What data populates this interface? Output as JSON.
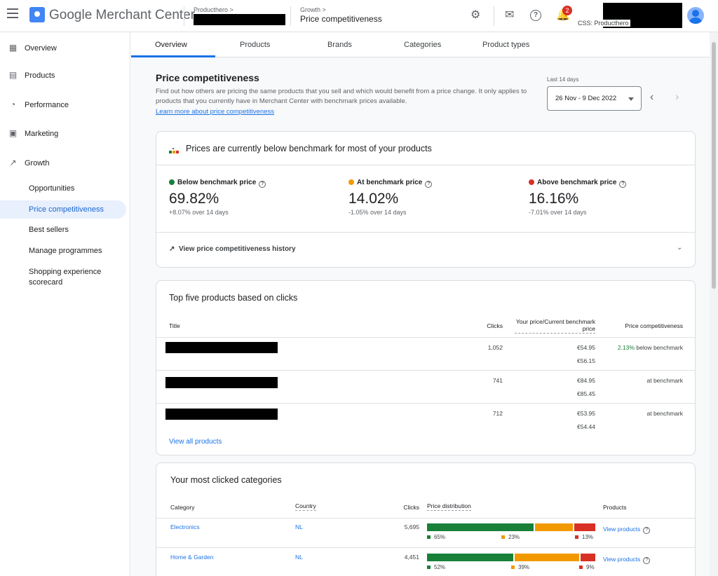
{
  "header": {
    "app_name": "Google Merchant Center",
    "account_breadcrumb": "Producthero",
    "section_breadcrumb": "Growth",
    "page_name": "Price competitiveness",
    "notification_count": "2",
    "css_label": "CSS: Producthero",
    "breadcrumb_chevron": ">"
  },
  "sidebar": {
    "items": [
      {
        "label": "Overview",
        "icon": "dashboard-icon"
      },
      {
        "label": "Products",
        "icon": "list-icon"
      },
      {
        "label": "Performance",
        "icon": "performance-icon"
      },
      {
        "label": "Marketing",
        "icon": "marketing-icon"
      },
      {
        "label": "Growth",
        "icon": "trending-up-icon"
      }
    ],
    "growth_sub": [
      {
        "label": "Opportunities"
      },
      {
        "label": "Price competitiveness"
      },
      {
        "label": "Best sellers"
      },
      {
        "label": "Manage programmes"
      },
      {
        "label": "Shopping experience scorecard"
      }
    ]
  },
  "tabs": [
    "Overview",
    "Products",
    "Brands",
    "Categories",
    "Product types"
  ],
  "page": {
    "title": "Price competitiveness",
    "description": "Find out how others are pricing the same products that you sell and which would benefit from a price change. It only applies to products that you currently have in Merchant Center with benchmark prices available.",
    "learn_more": "Learn more about price competitiveness",
    "date_label": "Last 14 days",
    "date_value": "26 Nov - 9 Dec 2022"
  },
  "summary_card": {
    "header": "Prices are currently below benchmark for most of your products",
    "metrics": [
      {
        "label": "Below benchmark price",
        "value": "69.82%",
        "sub": "+8.07% over 14 days",
        "color": "#188038"
      },
      {
        "label": "At benchmark price",
        "value": "14.02%",
        "sub": "-1.05% over 14 days",
        "color": "#f29900"
      },
      {
        "label": "Above benchmark price",
        "value": "16.16%",
        "sub": "-7.01% over 14 days",
        "color": "#d93025"
      }
    ],
    "history_link": "View price competitiveness history"
  },
  "top_products": {
    "title": "Top five products based on clicks",
    "columns": {
      "title": "Title",
      "clicks": "Clicks",
      "price": "Your price/Current benchmark price",
      "competitiveness": "Price competitiveness"
    },
    "rows": [
      {
        "clicks": "1,052",
        "your_price": "€54.95",
        "benchmark": "€56.15",
        "comp_value": "2.13%",
        "comp_text": " below benchmark"
      },
      {
        "clicks": "741",
        "your_price": "€84.95",
        "benchmark": "€85.45",
        "comp_value": "",
        "comp_text": "at benchmark"
      },
      {
        "clicks": "712",
        "your_price": "€53.95",
        "benchmark": "€54.44",
        "comp_value": "",
        "comp_text": "at benchmark"
      }
    ],
    "view_all": "View all products"
  },
  "categories": {
    "title": "Your most clicked categories",
    "columns": {
      "category": "Category",
      "country": "Country",
      "clicks": "Clicks",
      "distribution": "Price distribution",
      "products": "Products"
    },
    "rows": [
      {
        "category": "Electronics",
        "country": "NL",
        "clicks": "5,695",
        "below": 65,
        "at": 23,
        "above": 13,
        "below_label": "65%",
        "at_label": "23%",
        "above_label": "13%",
        "products_link": "View products"
      },
      {
        "category": "Home & Garden",
        "country": "NL",
        "clicks": "4,451",
        "below": 52,
        "at": 39,
        "above": 9,
        "below_label": "52%",
        "at_label": "39%",
        "above_label": "9%",
        "products_link": "View products"
      }
    ]
  },
  "colors": {
    "accent": "#1a73e8",
    "below": "#188038",
    "at": "#f29900",
    "above": "#d93025"
  }
}
